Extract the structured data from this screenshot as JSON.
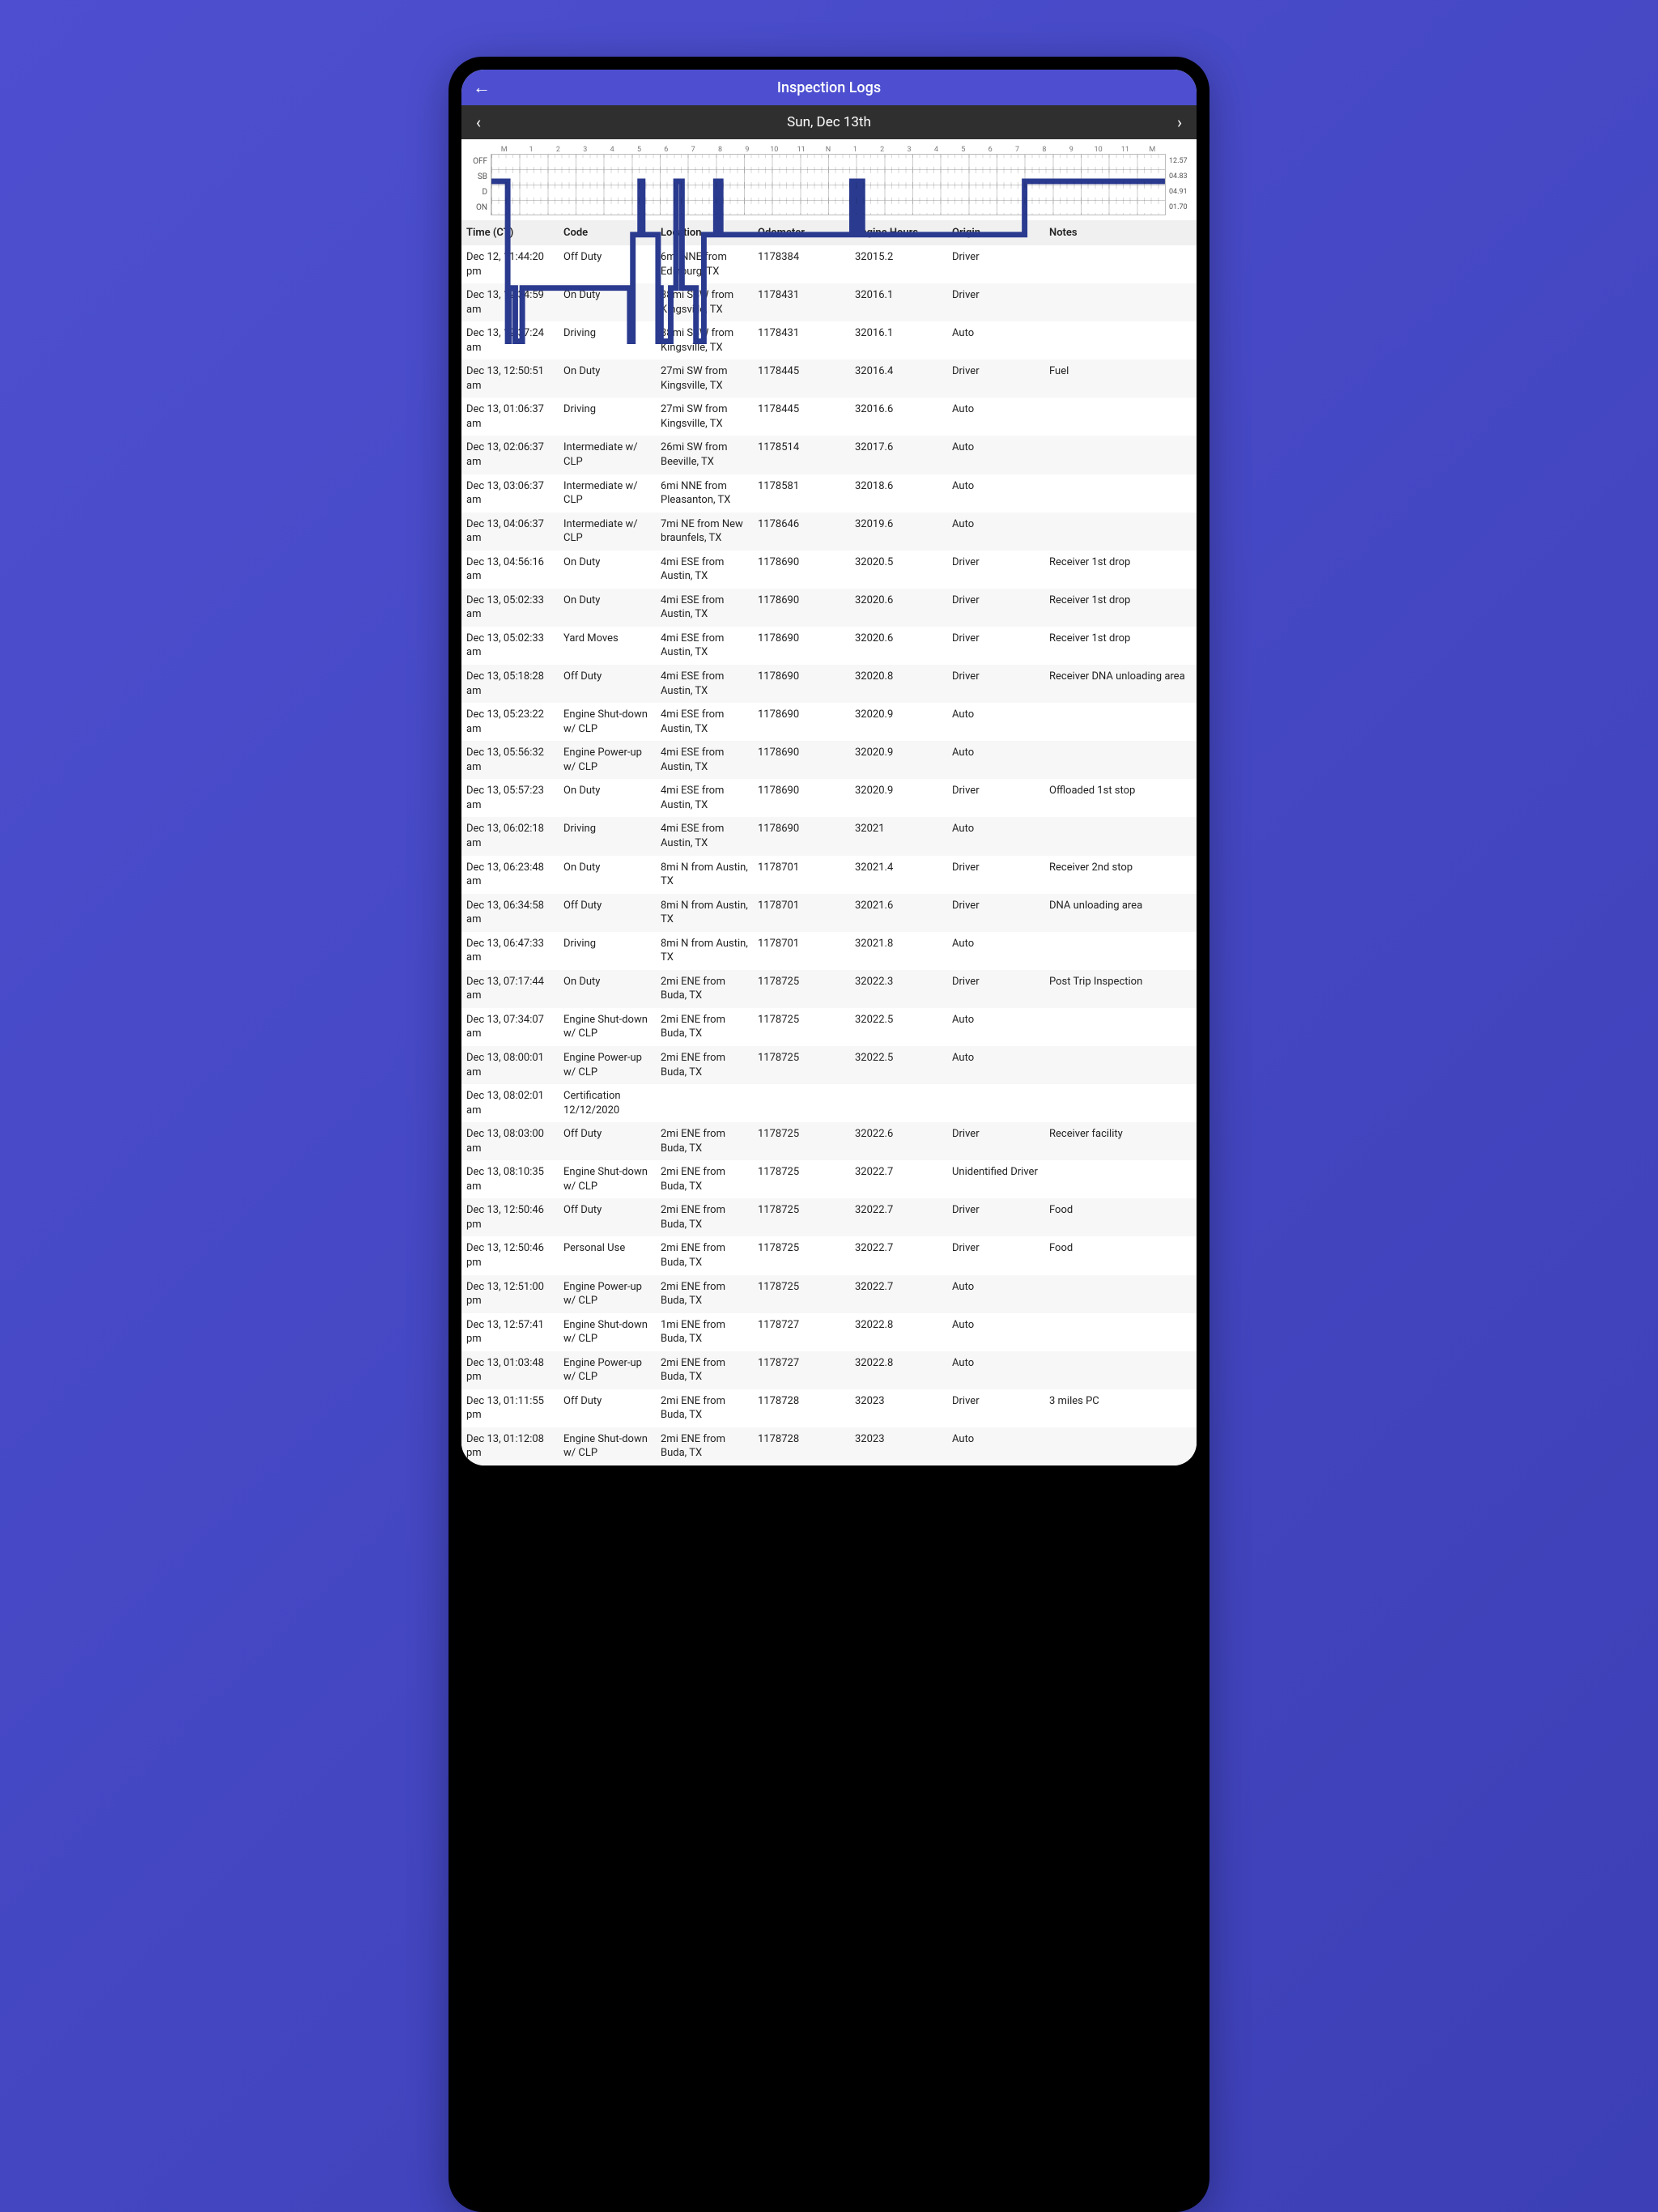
{
  "header": {
    "title": "Inspection Logs"
  },
  "dateBar": {
    "label": "Sun, Dec 13th"
  },
  "chart_data": {
    "type": "step-line",
    "row_labels": [
      "OFF",
      "SB",
      "D",
      "ON"
    ],
    "hour_labels_top": [
      "M",
      "1",
      "2",
      "3",
      "4",
      "5",
      "6",
      "7",
      "8",
      "9",
      "10",
      "11",
      "N",
      "1",
      "2",
      "3",
      "4",
      "5",
      "6",
      "7",
      "8",
      "9",
      "10",
      "11",
      "M"
    ],
    "row_totals": [
      "12.57",
      "04.83",
      "04.91",
      "01.70"
    ],
    "series": [
      {
        "name": "duty-status",
        "points": [
          [
            0.0,
            0
          ],
          [
            0.58,
            0
          ],
          [
            0.58,
            3
          ],
          [
            0.63,
            3
          ],
          [
            0.63,
            2
          ],
          [
            0.85,
            2
          ],
          [
            0.85,
            3
          ],
          [
            1.1,
            3
          ],
          [
            1.1,
            2
          ],
          [
            4.93,
            2
          ],
          [
            4.93,
            3
          ],
          [
            5.04,
            3
          ],
          [
            5.04,
            1
          ],
          [
            5.3,
            1
          ],
          [
            5.3,
            0
          ],
          [
            5.39,
            0
          ],
          [
            5.39,
            1
          ],
          [
            5.94,
            1
          ],
          [
            5.94,
            3
          ],
          [
            5.96,
            3
          ],
          [
            5.96,
            2
          ],
          [
            6.04,
            2
          ],
          [
            6.04,
            3
          ],
          [
            6.39,
            3
          ],
          [
            6.39,
            2
          ],
          [
            6.58,
            2
          ],
          [
            6.58,
            0
          ],
          [
            6.79,
            0
          ],
          [
            6.79,
            2
          ],
          [
            7.29,
            2
          ],
          [
            7.29,
            3
          ],
          [
            7.57,
            3
          ],
          [
            7.57,
            1
          ],
          [
            8.0,
            1
          ],
          [
            8.0,
            0
          ],
          [
            8.17,
            0
          ],
          [
            8.17,
            1
          ],
          [
            12.85,
            1
          ],
          [
            12.85,
            0
          ],
          [
            12.87,
            0
          ],
          [
            12.87,
            1
          ],
          [
            13.02,
            1
          ],
          [
            13.02,
            0
          ],
          [
            13.06,
            0
          ],
          [
            13.06,
            1
          ],
          [
            13.2,
            1
          ],
          [
            13.2,
            0
          ],
          [
            13.22,
            0
          ],
          [
            13.22,
            1
          ],
          [
            19.0,
            1
          ],
          [
            19.0,
            0
          ],
          [
            24.0,
            0
          ]
        ]
      }
    ],
    "x_range": [
      0,
      24
    ],
    "y_categories": [
      "OFF",
      "SB",
      "D",
      "ON"
    ]
  },
  "table": {
    "columns": [
      "Time (CT)",
      "Code",
      "Location",
      "Odometer",
      "Engine Hours",
      "Origin",
      "Notes"
    ],
    "rows": [
      {
        "time": "Dec 12, 11:44:20 pm",
        "code": "Off Duty",
        "loc": "6mi NNE from Edinburg, TX",
        "odo": "1178384",
        "eng": "32015.2",
        "org": "Driver",
        "notes": ""
      },
      {
        "time": "Dec 13, 12:34:59 am",
        "code": "On Duty",
        "loc": "38mi SSW from Kingsville, TX",
        "odo": "1178431",
        "eng": "32016.1",
        "org": "Driver",
        "notes": ""
      },
      {
        "time": "Dec 13, 12:37:24 am",
        "code": "Driving",
        "loc": "38mi SSW from Kingsville, TX",
        "odo": "1178431",
        "eng": "32016.1",
        "org": "Auto",
        "notes": ""
      },
      {
        "time": "Dec 13, 12:50:51 am",
        "code": "On Duty",
        "loc": "27mi SW from Kingsville, TX",
        "odo": "1178445",
        "eng": "32016.4",
        "org": "Driver",
        "notes": "Fuel"
      },
      {
        "time": "Dec 13, 01:06:37 am",
        "code": "Driving",
        "loc": "27mi SW from Kingsville, TX",
        "odo": "1178445",
        "eng": "32016.6",
        "org": "Auto",
        "notes": ""
      },
      {
        "time": "Dec 13, 02:06:37 am",
        "code": "Intermediate w/ CLP",
        "loc": "26mi SW from Beeville, TX",
        "odo": "1178514",
        "eng": "32017.6",
        "org": "Auto",
        "notes": ""
      },
      {
        "time": "Dec 13, 03:06:37 am",
        "code": "Intermediate w/ CLP",
        "loc": "6mi NNE from Pleasanton, TX",
        "odo": "1178581",
        "eng": "32018.6",
        "org": "Auto",
        "notes": ""
      },
      {
        "time": "Dec 13, 04:06:37 am",
        "code": "Intermediate w/ CLP",
        "loc": "7mi NE from New braunfels, TX",
        "odo": "1178646",
        "eng": "32019.6",
        "org": "Auto",
        "notes": ""
      },
      {
        "time": "Dec 13, 04:56:16 am",
        "code": "On Duty",
        "loc": "4mi ESE from Austin, TX",
        "odo": "1178690",
        "eng": "32020.5",
        "org": "Driver",
        "notes": "Receiver 1st drop"
      },
      {
        "time": "Dec 13, 05:02:33 am",
        "code": "On Duty",
        "loc": "4mi ESE from Austin, TX",
        "odo": "1178690",
        "eng": "32020.6",
        "org": "Driver",
        "notes": "Receiver 1st drop"
      },
      {
        "time": "Dec 13, 05:02:33 am",
        "code": "Yard Moves",
        "loc": "4mi ESE from Austin, TX",
        "odo": "1178690",
        "eng": "32020.6",
        "org": "Driver",
        "notes": "Receiver 1st drop"
      },
      {
        "time": "Dec 13, 05:18:28 am",
        "code": "Off Duty",
        "loc": "4mi ESE from Austin, TX",
        "odo": "1178690",
        "eng": "32020.8",
        "org": "Driver",
        "notes": "Receiver DNA unloading area"
      },
      {
        "time": "Dec 13, 05:23:22 am",
        "code": "Engine Shut-down w/ CLP",
        "loc": "4mi ESE from Austin, TX",
        "odo": "1178690",
        "eng": "32020.9",
        "org": "Auto",
        "notes": ""
      },
      {
        "time": "Dec 13, 05:56:32 am",
        "code": "Engine Power-up w/ CLP",
        "loc": "4mi ESE from Austin, TX",
        "odo": "1178690",
        "eng": "32020.9",
        "org": "Auto",
        "notes": ""
      },
      {
        "time": "Dec 13, 05:57:23 am",
        "code": "On Duty",
        "loc": "4mi ESE from Austin, TX",
        "odo": "1178690",
        "eng": "32020.9",
        "org": "Driver",
        "notes": "Offloaded 1st stop"
      },
      {
        "time": "Dec 13, 06:02:18 am",
        "code": "Driving",
        "loc": "4mi ESE from Austin, TX",
        "odo": "1178690",
        "eng": "32021",
        "org": "Auto",
        "notes": ""
      },
      {
        "time": "Dec 13, 06:23:48 am",
        "code": "On Duty",
        "loc": "8mi N from Austin, TX",
        "odo": "1178701",
        "eng": "32021.4",
        "org": "Driver",
        "notes": "Receiver 2nd stop"
      },
      {
        "time": "Dec 13, 06:34:58 am",
        "code": "Off Duty",
        "loc": "8mi N from Austin, TX",
        "odo": "1178701",
        "eng": "32021.6",
        "org": "Driver",
        "notes": "DNA unloading area"
      },
      {
        "time": "Dec 13, 06:47:33 am",
        "code": "Driving",
        "loc": "8mi N from Austin, TX",
        "odo": "1178701",
        "eng": "32021.8",
        "org": "Auto",
        "notes": ""
      },
      {
        "time": "Dec 13, 07:17:44 am",
        "code": "On Duty",
        "loc": "2mi ENE from Buda, TX",
        "odo": "1178725",
        "eng": "32022.3",
        "org": "Driver",
        "notes": "Post Trip Inspection"
      },
      {
        "time": "Dec 13, 07:34:07 am",
        "code": "Engine Shut-down w/ CLP",
        "loc": "2mi ENE from Buda, TX",
        "odo": "1178725",
        "eng": "32022.5",
        "org": "Auto",
        "notes": ""
      },
      {
        "time": "Dec 13, 08:00:01 am",
        "code": "Engine Power-up w/ CLP",
        "loc": "2mi ENE from Buda, TX",
        "odo": "1178725",
        "eng": "32022.5",
        "org": "Auto",
        "notes": ""
      },
      {
        "time": "Dec 13, 08:02:01 am",
        "code": "Certification 12/12/2020",
        "loc": "",
        "odo": "",
        "eng": "",
        "org": "",
        "notes": ""
      },
      {
        "time": "Dec 13, 08:03:00 am",
        "code": "Off Duty",
        "loc": "2mi ENE from Buda, TX",
        "odo": "1178725",
        "eng": "32022.6",
        "org": "Driver",
        "notes": "Receiver facility"
      },
      {
        "time": "Dec 13, 08:10:35 am",
        "code": "Engine Shut-down w/ CLP",
        "loc": "2mi ENE from Buda, TX",
        "odo": "1178725",
        "eng": "32022.7",
        "org": "Unidentified Driver",
        "notes": ""
      },
      {
        "time": "Dec 13, 12:50:46 pm",
        "code": "Off Duty",
        "loc": "2mi ENE from Buda, TX",
        "odo": "1178725",
        "eng": "32022.7",
        "org": "Driver",
        "notes": "Food"
      },
      {
        "time": "Dec 13, 12:50:46 pm",
        "code": "Personal Use",
        "loc": "2mi ENE from Buda, TX",
        "odo": "1178725",
        "eng": "32022.7",
        "org": "Driver",
        "notes": "Food"
      },
      {
        "time": "Dec 13, 12:51:00 pm",
        "code": "Engine Power-up w/ CLP",
        "loc": "2mi ENE from Buda, TX",
        "odo": "1178725",
        "eng": "32022.7",
        "org": "Auto",
        "notes": ""
      },
      {
        "time": "Dec 13, 12:57:41 pm",
        "code": "Engine Shut-down w/ CLP",
        "loc": "1mi ENE from Buda, TX",
        "odo": "1178727",
        "eng": "32022.8",
        "org": "Auto",
        "notes": ""
      },
      {
        "time": "Dec 13, 01:03:48 pm",
        "code": "Engine Power-up w/ CLP",
        "loc": "2mi ENE from Buda, TX",
        "odo": "1178727",
        "eng": "32022.8",
        "org": "Auto",
        "notes": ""
      },
      {
        "time": "Dec 13, 01:11:55 pm",
        "code": "Off Duty",
        "loc": "2mi ENE from Buda, TX",
        "odo": "1178728",
        "eng": "32023",
        "org": "Driver",
        "notes": "3 miles PC"
      },
      {
        "time": "Dec 13, 01:12:08 pm",
        "code": "Engine Shut-down w/ CLP",
        "loc": "2mi ENE from Buda, TX",
        "odo": "1178728",
        "eng": "32023",
        "org": "Auto",
        "notes": ""
      }
    ]
  }
}
